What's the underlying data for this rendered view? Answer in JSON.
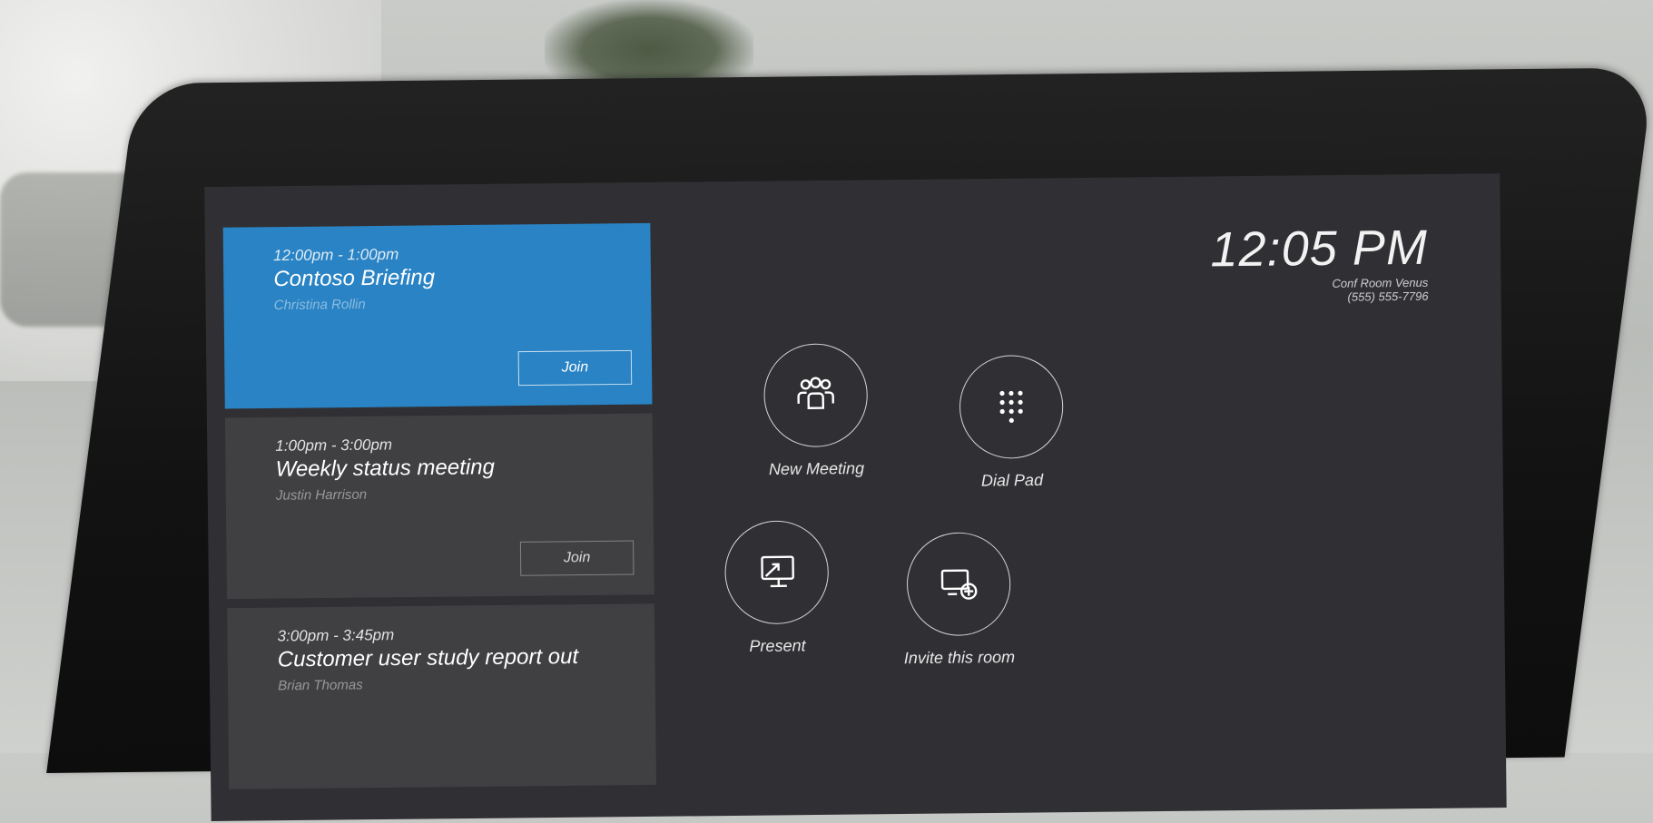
{
  "meetings": [
    {
      "time": "12:00pm - 1:00pm",
      "title": "Contoso Briefing",
      "host": "Christina Rollin",
      "join_label": "Join",
      "active": true
    },
    {
      "time": "1:00pm - 3:00pm",
      "title": "Weekly status meeting",
      "host": "Justin Harrison",
      "join_label": "Join",
      "active": false
    },
    {
      "time": "3:00pm - 3:45pm",
      "title": "Customer user study report out",
      "host": "Brian Thomas",
      "join_label": "",
      "active": false
    }
  ],
  "clock": {
    "time": "12:05 PM",
    "room": "Conf Room Venus",
    "phone": "(555) 555-7796"
  },
  "actions": {
    "new_meeting": "New Meeting",
    "dial_pad": "Dial Pad",
    "present": "Present",
    "invite": "Invite this room"
  },
  "colors": {
    "accent": "#2a83c4",
    "screen": "#303034",
    "card": "#404043"
  },
  "icons": {
    "new_meeting": "group-icon",
    "dial_pad": "dialpad-icon",
    "present": "present-screen-icon",
    "invite": "invite-room-icon"
  }
}
